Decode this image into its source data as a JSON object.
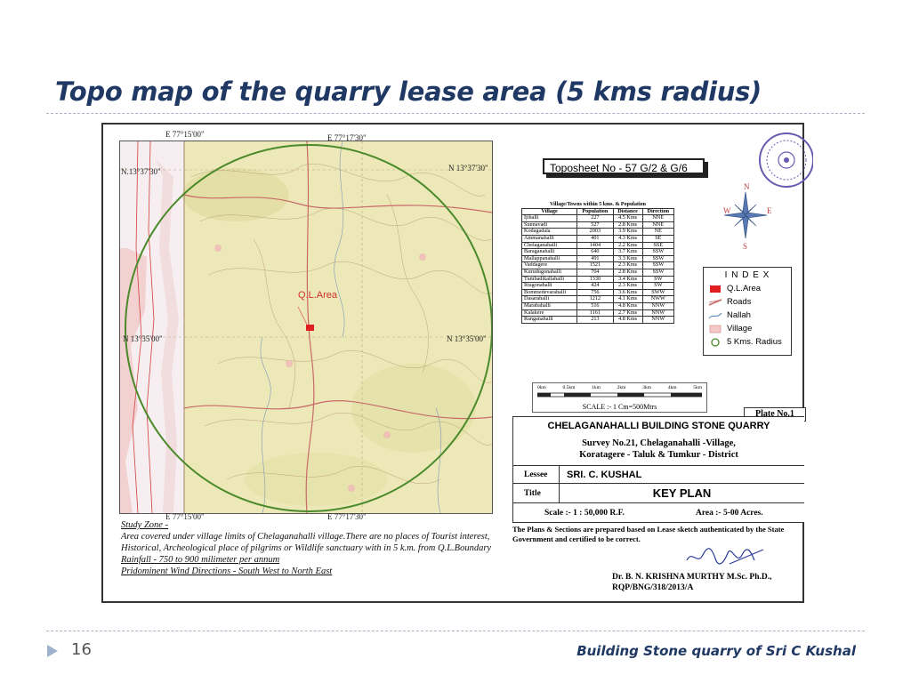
{
  "slide": {
    "title": "Topo map of the quarry lease area (5 kms radius)",
    "page_number": "16",
    "footer": "Building Stone quarry of  Sri C Kushal"
  },
  "map": {
    "coord_top_left": "E 77°15'00\"",
    "coord_top_right": "E 77°17'30\"",
    "coord_bottom_left": "E 77°15'00\"",
    "coord_bottom_right": "E 77°17'30\"",
    "coord_left_top": "N.13°37'30\"",
    "coord_right_top": "N 13°37'30\"",
    "coord_left_mid": "N 13°35'00\"",
    "coord_right_mid": "N 13°35'00\"",
    "lease_label": "Q.L.Area",
    "colors": {
      "terrain": "#ece8b8",
      "radius_circle": "#4a8a2a",
      "lease": "#e02020",
      "village": "#f3c9c9",
      "roads": "#c96a6a"
    }
  },
  "toposheet": "Toposheet No - 57 G/2 & G/6",
  "village_table": {
    "caption": "Village/Towns within 5 kms. & Population",
    "headers": [
      "Village",
      "Population",
      "Distance",
      "Direction"
    ],
    "rows": [
      [
        "Ijihalli",
        "227",
        "4.5 Kms",
        "NNE"
      ],
      [
        "Sunnavadi",
        "527",
        "2.8 Kms",
        "NNE"
      ],
      [
        "Kodagadala",
        "2003",
        "3.9 Kms",
        "NE"
      ],
      [
        "Ammanahalli",
        "401",
        "4.3 Kms",
        "SE"
      ],
      [
        "Chelaganahalli",
        "1404",
        "2.2 Kms",
        "SSE"
      ],
      [
        "Baraganahalli",
        "640",
        "3.7 Kms",
        "SSW"
      ],
      [
        "Mallappanahalli",
        "491",
        "3.3 Kms",
        "SSW"
      ],
      [
        "Vaddagere",
        "1521",
        "2.3 Kms",
        "SSW"
      ],
      [
        "Kurudugonahalli",
        "704",
        "2.8 Kms",
        "SSW"
      ],
      [
        "Tumbadikallahalli",
        "1330",
        "3.4 Kms",
        "SW"
      ],
      [
        "Ittugonahalli",
        "424",
        "2.3 Kms",
        "SW"
      ],
      [
        "Bommedevarahalli",
        "756",
        "3.6 Kms",
        "SWW"
      ],
      [
        "Dasarahalli",
        "1212",
        "4.1 Kms",
        "NWW"
      ],
      [
        "Marabahalli",
        "516",
        "4.8 Kms",
        "NNW"
      ],
      [
        "Kalakere",
        "1161",
        "2.7 Kms",
        "NNW"
      ],
      [
        "Ranganahalli",
        "213",
        "4.8 Kms",
        "NNW"
      ]
    ]
  },
  "index": {
    "title": "I N D E X",
    "items": [
      {
        "label": "Q.L.Area",
        "icon": "lease-area-symbol"
      },
      {
        "label": "Roads",
        "icon": "roads-symbol"
      },
      {
        "label": "Nallah",
        "icon": "nallah-symbol"
      },
      {
        "label": "Village",
        "icon": "village-symbol"
      },
      {
        "label": "5 Kms. Radius",
        "icon": "radius-circle-symbol"
      }
    ]
  },
  "scale_bar": {
    "ticks": [
      "0km",
      "0.5km",
      "1km",
      "2km",
      "3km",
      "4km",
      "5km"
    ],
    "label": "SCALE :- 1 Cm=500Mtrs"
  },
  "compass": {
    "n": "N",
    "s": "S",
    "e": "E",
    "w": "W"
  },
  "title_block": {
    "plate": "Plate No.1",
    "quarry_name": "CHELAGANAHALLI BUILDING STONE QUARRY",
    "survey_line1": "Survey No.21, Chelaganahalli -Village,",
    "survey_line2": "Koratagere - Taluk & Tumkur - District",
    "lessee_label": "Lessee",
    "lessee_value": "SRI. C. KUSHAL",
    "title_label": "Title",
    "title_value": "KEY PLAN",
    "scale": "Scale :- 1 : 50,000 R.F.",
    "area": "Area :- 5-00 Acres.",
    "note": "The Plans & Sections are prepared based on Lease sketch authenticated by the State Government and certified to be correct.",
    "signer_name": "Dr. B. N. KRISHNA MURTHY M.Sc. Ph.D.,",
    "signer_reg": "RQP/BNG/318/2013/A"
  },
  "study_zone": {
    "title": "Study Zone -",
    "text": "Area covered under village limits of Chelaganahalli village.There are no places of Tourist interest, Historical, Archeological place of pilgrims or Wildlife sanctuary with in 5 k.m. from Q.L.Boundary",
    "rainfall": "Rainfall -   750 to 900 milimeter per annum",
    "wind": "Pridominent Wind Directions - South West to North East"
  }
}
